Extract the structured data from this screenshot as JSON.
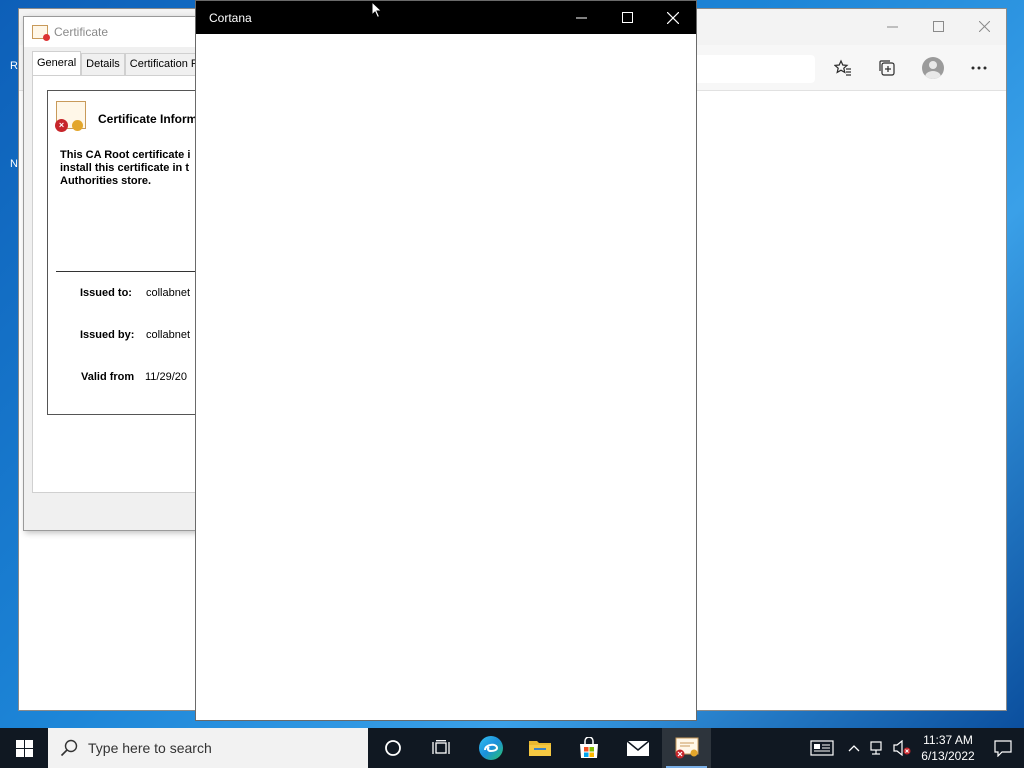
{
  "desktop": {
    "icon_labels": [
      "R",
      "N"
    ]
  },
  "browser": {
    "minimize_icon": "minimize-icon",
    "maximize_icon": "maximize-icon",
    "close_icon": "close-icon"
  },
  "certificate": {
    "window_title": "Certificate",
    "tabs": [
      "General",
      "Details",
      "Certification P"
    ],
    "info_title": "Certificate Inform",
    "warning_text": "This CA Root certificate i\ninstall this certificate in t\nAuthorities store.",
    "issued_to_label": "Issued to:",
    "issued_to_value": "collabnet",
    "issued_by_label": "Issued by:",
    "issued_by_value": "collabnet",
    "valid_from_label": "Valid from",
    "valid_from_value": "11/29/20"
  },
  "cortana": {
    "title": "Cortana"
  },
  "taskbar": {
    "search_placeholder": "Type here to search",
    "time": "11:37 AM",
    "date": "6/13/2022",
    "apps": [
      "cortana",
      "task-view",
      "edge",
      "file-explorer",
      "store",
      "mail",
      "certificate"
    ]
  },
  "colors": {
    "taskbar": "#101822",
    "cortana_titlebar": "#000000",
    "desktop": "#1d86d8"
  }
}
